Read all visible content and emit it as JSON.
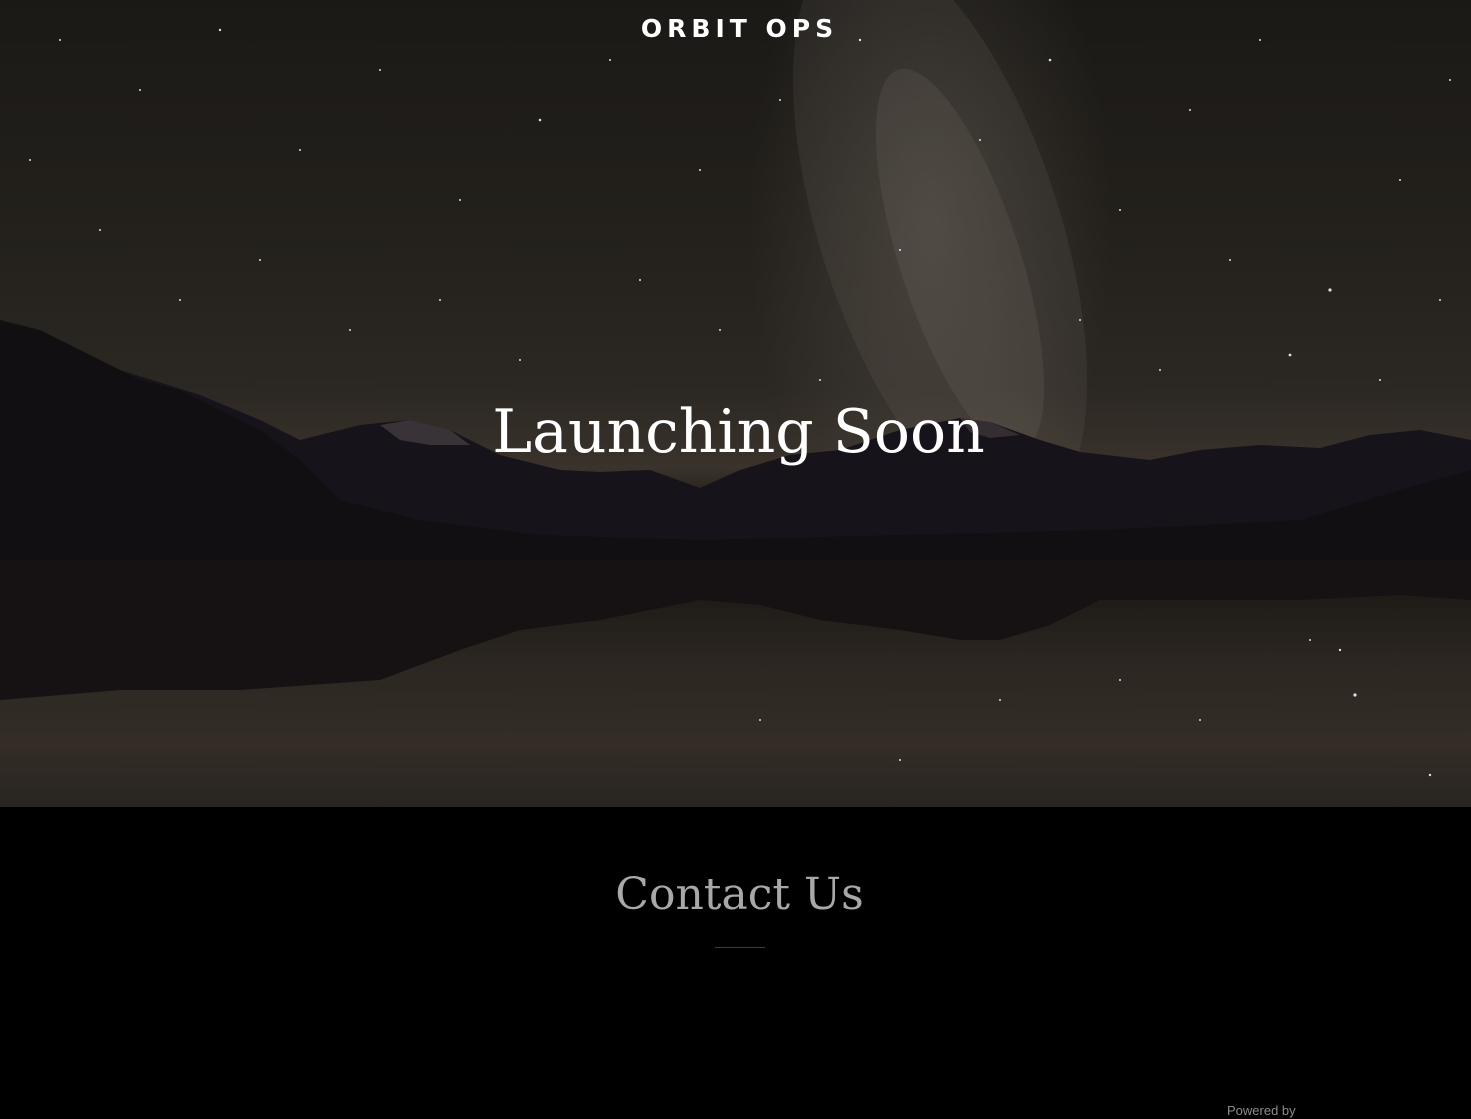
{
  "header": {
    "brand": "ORBIT OPS"
  },
  "hero": {
    "headline": "Launching Soon",
    "background_image": "starry-night-mountain-lake"
  },
  "contact": {
    "title": "Contact Us"
  },
  "footer": {
    "powered_by": "Powered by"
  },
  "colors": {
    "page_background": "#000000",
    "hero_text": "#ffffff",
    "contact_title": "#a8a8a8"
  }
}
